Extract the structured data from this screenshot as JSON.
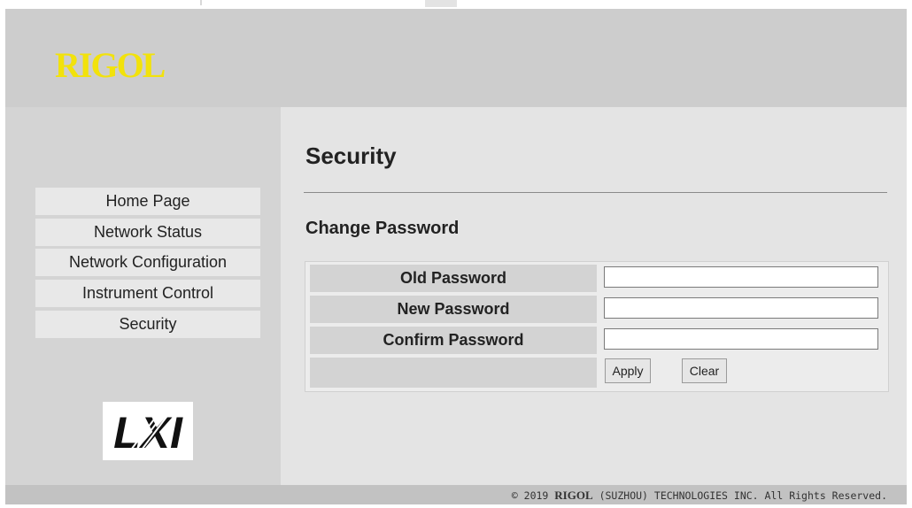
{
  "header": {
    "brand": "RIGOL"
  },
  "sidebar": {
    "items": [
      {
        "label": "Home Page"
      },
      {
        "label": "Network Status"
      },
      {
        "label": "Network Configuration"
      },
      {
        "label": "Instrument Control"
      },
      {
        "label": "Security"
      }
    ],
    "logo": "LXI"
  },
  "main": {
    "title": "Security",
    "section_title": "Change Password",
    "form": {
      "old_password_label": "Old Password",
      "old_password_value": "",
      "new_password_label": "New Password",
      "new_password_value": "",
      "confirm_password_label": "Confirm Password",
      "confirm_password_value": "",
      "apply_label": "Apply",
      "clear_label": "Clear"
    }
  },
  "footer": {
    "copyright_symbol": "©",
    "year": "2019",
    "brand": "RIGOL",
    "rest": "(SUZHOU) TECHNOLOGIES INC. All Rights Reserved."
  },
  "colors": {
    "brand_yellow": "#f2e20b",
    "header_bg": "#cdcdcd",
    "sidebar_bg": "#d4d4d4",
    "main_bg": "#e4e4e4",
    "nav_item_bg": "#e8e8e8",
    "footer_bg": "#c2c2c2"
  }
}
